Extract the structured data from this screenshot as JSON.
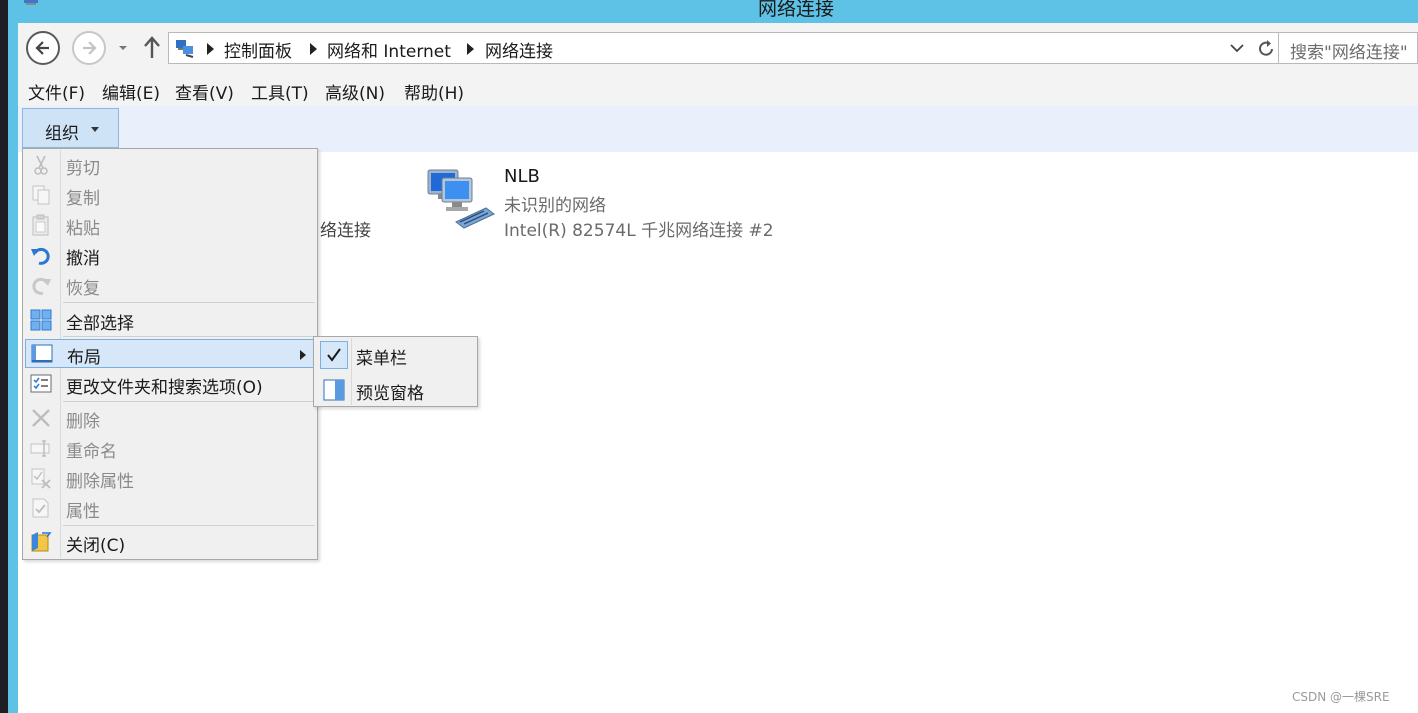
{
  "window": {
    "title": "网络连接"
  },
  "address": {
    "crumbs": [
      "控制面板",
      "网络和 Internet",
      "网络连接"
    ],
    "search_placeholder": "搜索\"网络连接\""
  },
  "menubar": {
    "items": [
      "文件(F)",
      "编辑(E)",
      "查看(V)",
      "工具(T)",
      "高级(N)",
      "帮助(H)"
    ]
  },
  "commandbar": {
    "organize_label": "组织"
  },
  "content": {
    "partial_item_text": "络连接",
    "connection": {
      "name": "NLB",
      "status": "未识别的网络",
      "adapter": "Intel(R) 82574L 千兆网络连接 #2"
    }
  },
  "organize_menu": {
    "items": [
      {
        "label": "剪切",
        "icon": "scissors-icon",
        "enabled": false
      },
      {
        "label": "复制",
        "icon": "copy-icon",
        "enabled": false
      },
      {
        "label": "粘贴",
        "icon": "paste-icon",
        "enabled": false
      },
      {
        "label": "撤消",
        "icon": "undo-icon",
        "enabled": true
      },
      {
        "label": "恢复",
        "icon": "redo-icon",
        "enabled": false
      },
      {
        "label": "全部选择",
        "icon": "select-all-icon",
        "enabled": true
      },
      {
        "label": "布局",
        "icon": "layout-icon",
        "enabled": true,
        "highlighted": true,
        "has_submenu": true
      },
      {
        "label": "更改文件夹和搜索选项(O)",
        "icon": "folder-options-icon",
        "enabled": true
      },
      {
        "label": "删除",
        "icon": "delete-icon",
        "enabled": false
      },
      {
        "label": "重命名",
        "icon": "rename-icon",
        "enabled": false
      },
      {
        "label": "删除属性",
        "icon": "remove-properties-icon",
        "enabled": false
      },
      {
        "label": "属性",
        "icon": "properties-icon",
        "enabled": false
      },
      {
        "label": "关闭(C)",
        "icon": "close-folder-icon",
        "enabled": true
      }
    ]
  },
  "layout_submenu": {
    "items": [
      {
        "label": "菜单栏",
        "icon": "checkmark-icon",
        "checked": true
      },
      {
        "label": "预览窗格",
        "icon": "preview-pane-icon",
        "checked": false
      }
    ]
  },
  "watermark": "CSDN @一棵SRE",
  "colors": {
    "titlebar": "#5ec2e6",
    "commandbar": "#e9f0fb",
    "menu_highlight": "#d5e7f8",
    "menu_border": "#7ab0e0"
  }
}
